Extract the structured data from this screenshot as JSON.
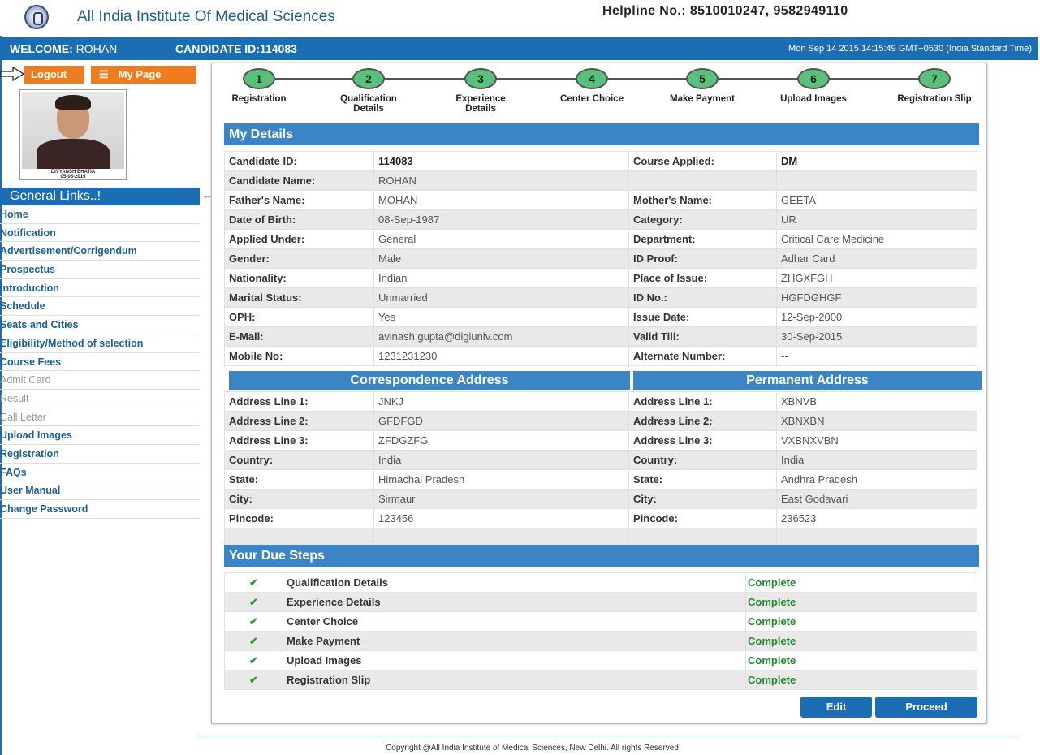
{
  "header": {
    "institute": "All India Institute Of Medical Sciences",
    "helpline": "Helpline No.: 8510010247, 9582949110"
  },
  "welcome": {
    "welcome_label": "WELCOME:",
    "name": "ROHAN",
    "candidate_label": "CANDIDATE ID:114083",
    "datetime": "Mon Sep 14 2015 14:15:49 GMT+0530 (India Standard Time)"
  },
  "sidebar": {
    "logout": "Logout",
    "mypage": "My Page",
    "menu_icon": "☰",
    "photo_name": "DIVYANSH BHATIA",
    "photo_date": "05-05-2015",
    "general_links": "General Links..!",
    "links": [
      {
        "label": "Home",
        "disabled": false
      },
      {
        "label": "Notification",
        "disabled": false
      },
      {
        "label": "Advertisement/Corrigendum",
        "disabled": false
      },
      {
        "label": "Prospectus",
        "disabled": false
      },
      {
        "label": "Introduction",
        "disabled": false
      },
      {
        "label": "Schedule",
        "disabled": false
      },
      {
        "label": "Seats and Cities",
        "disabled": false
      },
      {
        "label": "Eligibility/Method of selection",
        "disabled": false
      },
      {
        "label": "Course Fees",
        "disabled": false
      },
      {
        "label": "Admit Card",
        "disabled": true
      },
      {
        "label": "Result",
        "disabled": true
      },
      {
        "label": "Call Letter",
        "disabled": true
      },
      {
        "label": "Upload Images",
        "disabled": false
      },
      {
        "label": "Registration",
        "disabled": false
      },
      {
        "label": "FAQs",
        "disabled": false
      },
      {
        "label": "User Manual",
        "disabled": false
      },
      {
        "label": "Change Password",
        "disabled": false
      }
    ]
  },
  "steps": [
    {
      "num": "1",
      "label": "Registration"
    },
    {
      "num": "2",
      "label": "Qualification Details"
    },
    {
      "num": "3",
      "label": "Experience Details"
    },
    {
      "num": "4",
      "label": "Center Choice"
    },
    {
      "num": "5",
      "label": "Make Payment"
    },
    {
      "num": "6",
      "label": "Upload Images"
    },
    {
      "num": "7",
      "label": "Registration Slip"
    }
  ],
  "my_details": {
    "title": "My Details",
    "rows": [
      {
        "k1": "Candidate ID:",
        "v1": "114083",
        "k2": "Course Applied:",
        "v2": "DM"
      },
      {
        "k1": "Candidate Name:",
        "v1": "ROHAN",
        "k2": "",
        "v2": ""
      },
      {
        "k1": "Father's Name:",
        "v1": "MOHAN",
        "k2": "Mother's Name:",
        "v2": "GEETA"
      },
      {
        "k1": "Date of Birth:",
        "v1": "08-Sep-1987",
        "k2": "Category:",
        "v2": "UR"
      },
      {
        "k1": "Applied Under:",
        "v1": "General",
        "k2": "Department:",
        "v2": "Critical Care Medicine"
      },
      {
        "k1": "Gender:",
        "v1": "Male",
        "k2": "ID Proof:",
        "v2": "Adhar Card"
      },
      {
        "k1": "Nationality:",
        "v1": "Indian",
        "k2": "Place of Issue:",
        "v2": "ZHGXFGH"
      },
      {
        "k1": "Marital Status:",
        "v1": "Unmarried",
        "k2": "ID No.:",
        "v2": "HGFDGHGF"
      },
      {
        "k1": "OPH:",
        "v1": "Yes",
        "k2": "Issue Date:",
        "v2": "12-Sep-2000"
      },
      {
        "k1": "E-Mail:",
        "v1": "avinash.gupta@digiuniv.com",
        "k2": "Valid Till:",
        "v2": "30-Sep-2015"
      },
      {
        "k1": "Mobile No:",
        "v1": "1231231230",
        "k2": "Alternate Number:",
        "v2": "--"
      }
    ]
  },
  "address": {
    "corr_title": "Correspondence Address",
    "perm_title": "Permanent Address",
    "rows": [
      {
        "k1": "Address Line 1:",
        "v1": "JNKJ",
        "k2": "Address Line 1:",
        "v2": "XBNVB"
      },
      {
        "k1": "Address Line 2:",
        "v1": "GFDFGD",
        "k2": "Address Line 2:",
        "v2": "XBNXBN"
      },
      {
        "k1": "Address Line 3:",
        "v1": "ZFDGZFG",
        "k2": "Address Line 3:",
        "v2": "VXBNXVBN"
      },
      {
        "k1": "Country:",
        "v1": "India",
        "k2": "Country:",
        "v2": "India"
      },
      {
        "k1": "State:",
        "v1": "Himachal Pradesh",
        "k2": "State:",
        "v2": "Andhra Pradesh"
      },
      {
        "k1": "City:",
        "v1": "Sirmaur",
        "k2": "City:",
        "v2": "East Godavari"
      },
      {
        "k1": "Pincode:",
        "v1": "123456",
        "k2": "Pincode:",
        "v2": "236523"
      },
      {
        "k1": "",
        "v1": "",
        "k2": "",
        "v2": ""
      }
    ]
  },
  "due_steps": {
    "title": "Your Due Steps",
    "check": "✔",
    "rows": [
      {
        "name": "Qualification Details",
        "status": "Complete"
      },
      {
        "name": "Experience Details",
        "status": "Complete"
      },
      {
        "name": "Center Choice",
        "status": "Complete"
      },
      {
        "name": "Make Payment",
        "status": "Complete"
      },
      {
        "name": "Upload Images",
        "status": "Complete"
      },
      {
        "name": "Registration Slip",
        "status": "Complete"
      }
    ]
  },
  "actions": {
    "edit": "Edit",
    "proceed": "Proceed"
  },
  "footer": "Copyright @All India Institute of Medical Sciences, New Delhi. All rights Reserved"
}
